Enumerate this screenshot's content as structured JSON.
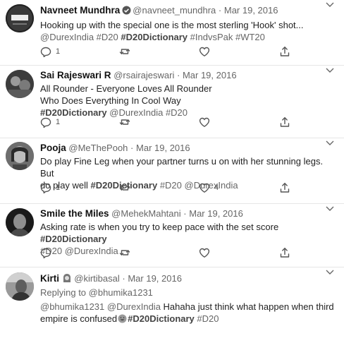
{
  "tweets": [
    {
      "name": "Navneet Mundhra",
      "handle": "@navneet_mundhra",
      "date": "Mar 19, 2016",
      "verified": true,
      "line1": "Hooking up with the special one is the most sterling 'Hook' shot...",
      "line2_a": "@DurexIndia #D20 ",
      "line2_b": "#D20Dictionary",
      "line2_c": " #IndvsPak #WT20",
      "reply_count": "1",
      "like_count": ""
    },
    {
      "name": "Sai Rajeswari R",
      "handle": "@rsairajeswari",
      "date": "Mar 19, 2016",
      "line1": "All Rounder - Everyone Loves All Rounder",
      "line2": "Who Does  Everything In Cool Way",
      "line3_a": "#D20Dictionary",
      "line3_b": " @DurexIndia #D20",
      "reply_count": "1",
      "like_count": ""
    },
    {
      "name": "Pooja",
      "handle": "@MeThePooh",
      "date": "Mar 19, 2016",
      "line1": "Do play Fine Leg when your partner turns u on with her stunning legs. But",
      "line2_a": "do play well ",
      "line2_b": "#D20Dictionary",
      "line2_c": " #D20 @DurexIndia",
      "reply_count": "1",
      "like_count": "4"
    },
    {
      "name": "Smile the Miles",
      "handle": "@MehekMahtani",
      "date": "Mar 19, 2016",
      "line1_a": "Asking rate is when you try to keep pace with the set score ",
      "line1_b": "#D20Dictionary",
      "line2": "#D20  @DurexIndia",
      "reply_count": "",
      "like_count": ""
    },
    {
      "name": "Kirti",
      "handle": "@kirtibasal",
      "date": "Mar 19, 2016",
      "replying": "Replying to @bhumika1231",
      "line1_a": "@bhumika1231 @DurexIndia ",
      "line1_b": "Hahaha just think what happen when third",
      "line2_a": "empire is confused",
      "line2_b": "#D20Dictionary",
      "line2_c": " #D20"
    }
  ],
  "separator": "·",
  "icons": [
    "reply-icon",
    "retweet-icon",
    "like-icon",
    "share-icon",
    "verified-badge-icon",
    "caret-down-icon"
  ],
  "colors": {
    "text": "#222222",
    "muted": "#666666",
    "divider": "#e6e6e6"
  }
}
